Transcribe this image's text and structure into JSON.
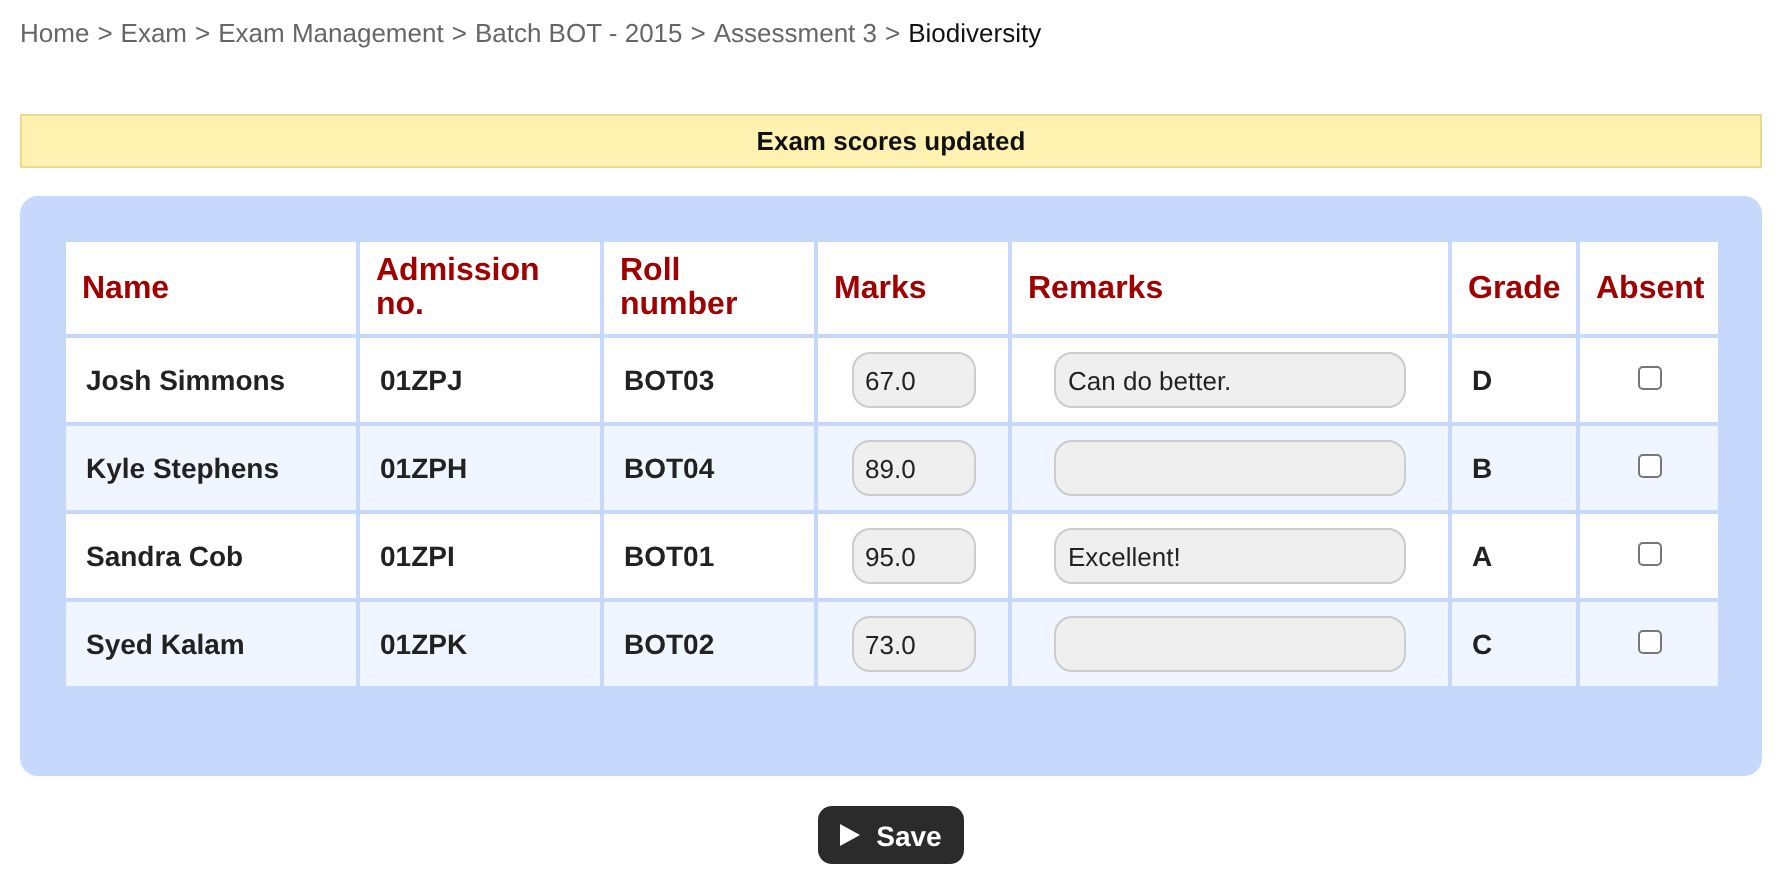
{
  "breadcrumb": {
    "separator": ">",
    "items": [
      {
        "label": "Home",
        "current": false
      },
      {
        "label": "Exam",
        "current": false
      },
      {
        "label": "Exam Management",
        "current": false
      },
      {
        "label": "Batch BOT - 2015",
        "current": false
      },
      {
        "label": "Assessment 3",
        "current": false
      },
      {
        "label": "Biodiversity",
        "current": true
      }
    ]
  },
  "notice": "Exam scores updated",
  "table": {
    "columns": [
      "Name",
      "Admission no.",
      "Roll number",
      "Marks",
      "Remarks",
      "Grade",
      "Absent"
    ],
    "rows": [
      {
        "name": "Josh Simmons",
        "admission": "01ZPJ",
        "roll": "BOT03",
        "marks": "67.0",
        "remarks": "Can do better.",
        "grade": "D",
        "absent": false
      },
      {
        "name": "Kyle Stephens",
        "admission": "01ZPH",
        "roll": "BOT04",
        "marks": "89.0",
        "grade": "B",
        "absent": false
      },
      {
        "name": "Sandra Cob",
        "admission": "01ZPI",
        "roll": "BOT01",
        "marks": "95.0",
        "remarks": "Excellent!",
        "grade": "A",
        "absent": false
      },
      {
        "name": "Syed Kalam",
        "admission": "01ZPK",
        "roll": "BOT02",
        "marks": "73.0",
        "grade": "C",
        "absent": false
      }
    ]
  },
  "save_button": "Save"
}
